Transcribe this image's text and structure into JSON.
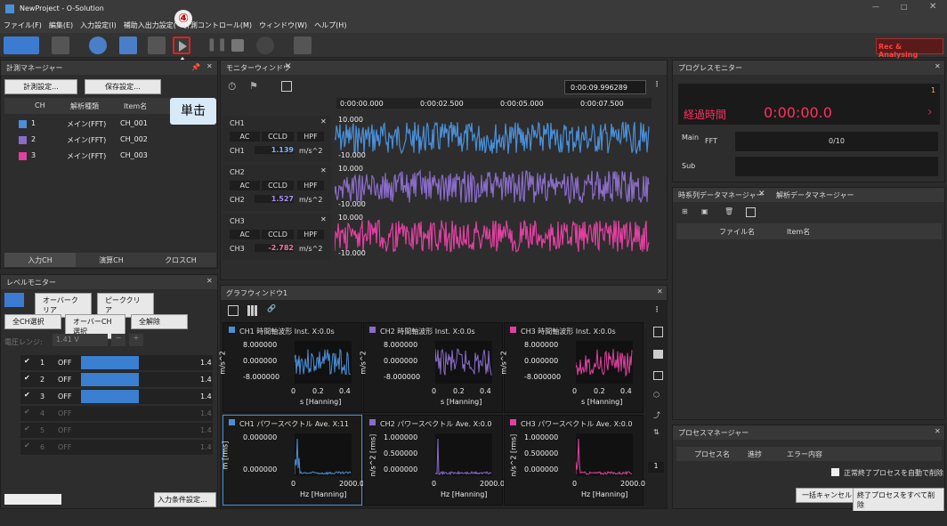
{
  "window": {
    "title": "NewProject - O-Solution"
  },
  "menu": [
    "ファイル(F)",
    "編集(E)",
    "入力設定(I)",
    "補助入出力設定(",
    "計測コントロール(M)",
    "ウィンドウ(W)",
    "ヘルプ(H)"
  ],
  "toolbar": {
    "rec_label": "Rec & Analysing",
    "annotation_number": "④",
    "annotation_text": "単击"
  },
  "measure_manager": {
    "title": "計測マネージャー",
    "btn_measure": "計測設定...",
    "btn_save": "保存設定...",
    "headers": [
      "CH",
      "解析種類",
      "Item名"
    ],
    "rows": [
      {
        "ch": "1",
        "type": "メイン(FFT)",
        "item": "CH_001",
        "color": "#4a8fd8"
      },
      {
        "ch": "2",
        "type": "メイン(FFT)",
        "item": "CH_002",
        "color": "#8a6cc8"
      },
      {
        "ch": "3",
        "type": "メイン(FFT)",
        "item": "CH_003",
        "color": "#e040a0"
      }
    ],
    "tabs": [
      "入力CH",
      "演算CH",
      "クロスCH"
    ]
  },
  "level_monitor": {
    "title": "レベルモニター",
    "btn_overclear": "オーバークリア",
    "btn_peakclear": "ピーククリア",
    "btn_allch": "全CH選択",
    "btn_overch": "オーバーCH選択",
    "btn_release": "全解除",
    "range_label": "電圧レンジ:",
    "range_value": "1.41 V",
    "rows": [
      {
        "n": "1",
        "state": "OFF",
        "active": true,
        "fill": 0.65
      },
      {
        "n": "2",
        "state": "OFF",
        "active": true,
        "fill": 0.65
      },
      {
        "n": "3",
        "state": "OFF",
        "active": true,
        "fill": 0.65
      },
      {
        "n": "4",
        "state": "OFF",
        "active": false,
        "fill": 0
      },
      {
        "n": "5",
        "state": "OFF",
        "active": false,
        "fill": 0
      },
      {
        "n": "6",
        "state": "OFF",
        "active": false,
        "fill": 0
      }
    ],
    "side_val": "1.4",
    "btn_input": "入力条件設定..."
  },
  "monitor": {
    "title": "モニターウィンドウ",
    "time": "0:00:09.996289",
    "ticks": [
      "0:00:00.000",
      "0:00:02.500",
      "0:00:05.000",
      "0:00:07.500"
    ],
    "channels": [
      {
        "name": "CH1",
        "ac": "AC",
        "ccld": "CCLD",
        "hpf": "HPF",
        "value": "1.139",
        "unit": "m/s^2",
        "color": "#4a8fd8",
        "vcolor": "#7fb0ff",
        "top": "10.000",
        "bot": "-10.000"
      },
      {
        "name": "CH2",
        "ac": "AC",
        "ccld": "CCLD",
        "hpf": "HPF",
        "value": "1.527",
        "unit": "m/s^2",
        "color": "#8a6cc8",
        "vcolor": "#a88ff0",
        "top": "10.000",
        "bot": "-10.000"
      },
      {
        "name": "CH3",
        "ac": "AC",
        "ccld": "CCLD",
        "hpf": "HPF",
        "value": "-2.782",
        "unit": "m/s^2",
        "color": "#e040a0",
        "vcolor": "#ff6fa0",
        "top": "10.000",
        "bot": "-10.000"
      }
    ]
  },
  "graph_window": {
    "title": "グラフウィンドウ1",
    "graphs": [
      {
        "title": "CH1 時間軸波形 Inst. X:0.0s",
        "color": "#4a8fd8",
        "yt": "8.000000",
        "ym": "0.000000",
        "yb": "-8.000000",
        "ylabel": "m/s^2",
        "x0": "0",
        "x1": "0.2",
        "x2": "0.4",
        "xlabel": "s [Hanning]"
      },
      {
        "title": "CH2 時間軸波形 Inst. X:0.0s",
        "color": "#8a6cc8",
        "yt": "8.000000",
        "ym": "0.000000",
        "yb": "-8.000000",
        "ylabel": "m/s^2",
        "x0": "0",
        "x1": "0.2",
        "x2": "0.4",
        "xlabel": "s [Hanning]"
      },
      {
        "title": "CH3 時間軸波形 Inst. X:0.0s",
        "color": "#e040a0",
        "yt": "8.000000",
        "ym": "0.000000",
        "yb": "-8.000000",
        "ylabel": "m/s^2",
        "x0": "0",
        "x1": "0.2",
        "x2": "0.4",
        "xlabel": "s [Hanning]"
      },
      {
        "title": "CH1 パワースペクトル Ave. X:11",
        "color": "#4a8fd8",
        "yt": "0.000000",
        "ym": "",
        "yb": "0.000000",
        "ylabel": "m [rms]",
        "x0": "0",
        "x1": "",
        "x2": "2000.0",
        "xlabel": "Hz [Hanning]"
      },
      {
        "title": "CH2 パワースペクトル Ave. X:0.0",
        "color": "#8a6cc8",
        "yt": "1.000000",
        "ym": "0.500000",
        "yb": "0.000000",
        "ylabel": "n/s^2 [rms]",
        "x0": "0",
        "x1": "",
        "x2": "2000.0",
        "xlabel": "Hz [Hanning]"
      },
      {
        "title": "CH3 パワースペクトル Ave. X:0.0",
        "color": "#e040a0",
        "yt": "1.000000",
        "ym": "0.500000",
        "yb": "0.000000",
        "ylabel": "n/s^2 [rms]",
        "x0": "0",
        "x1": "",
        "x2": "2000.0",
        "xlabel": "Hz [Hanning]"
      }
    ],
    "page": "1"
  },
  "progress_monitor": {
    "title": "プログレスモニター",
    "count": "1",
    "elapsed_label": "経過時間",
    "elapsed": "0:00:00.0",
    "main": "Main",
    "fft": "FFT",
    "progress": "0/10",
    "sub": "Sub"
  },
  "data_manager": {
    "tab1": "時系列データマネージャー",
    "tab2": "解析データマネージャー",
    "col_file": "ファイル名",
    "col_item": "Item名"
  },
  "process_manager": {
    "title": "プロセスマネージャー",
    "cols": [
      "プロセス名",
      "進捗",
      "エラー内容"
    ],
    "auto_delete": "正常終了プロセスを自動で削除",
    "btn_cancel": "一括キャンセル",
    "btn_delete": "終了プロセスをすべて削除"
  }
}
